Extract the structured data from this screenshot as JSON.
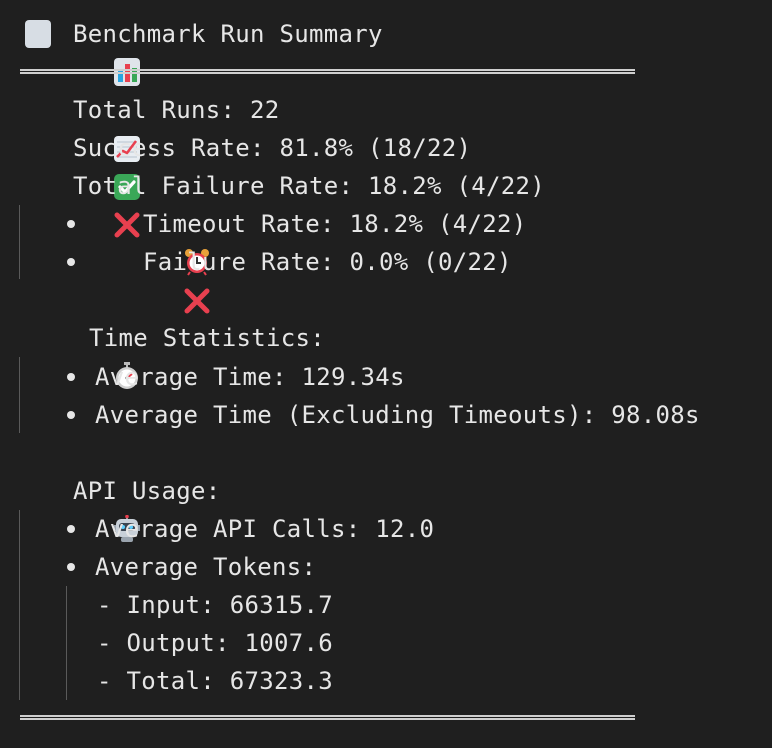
{
  "header": {
    "title": "Benchmark Run Summary",
    "icon": "bar-chart-icon"
  },
  "runs": {
    "total_label": "Total Runs: 22",
    "success_label": "Success Rate: 81.8% (18/22)",
    "failure_total_label": "Total Failure Rate: 18.2% (4/22)",
    "timeout_label": "Timeout Rate: 18.2% (4/22)",
    "failure_label": "Failure Rate: 0.0% (0/22)"
  },
  "time": {
    "heading": "Time Statistics:",
    "avg_time": "Average Time: 129.34s",
    "avg_time_excl": "Average Time (Excluding Timeouts): 98.08s"
  },
  "api": {
    "heading": "API Usage:",
    "avg_calls": "Average API Calls: 12.0",
    "avg_tokens": "Average Tokens:",
    "input": "- Input: 66315.7",
    "output": "- Output: 1007.6",
    "total": "- Total: 67323.3"
  },
  "colors": {
    "background": "#1f1f1f",
    "text": "#e6e6e6",
    "check_green": "#3aa757",
    "cross_red": "#e8404f",
    "rule": "#cfcfcf"
  }
}
